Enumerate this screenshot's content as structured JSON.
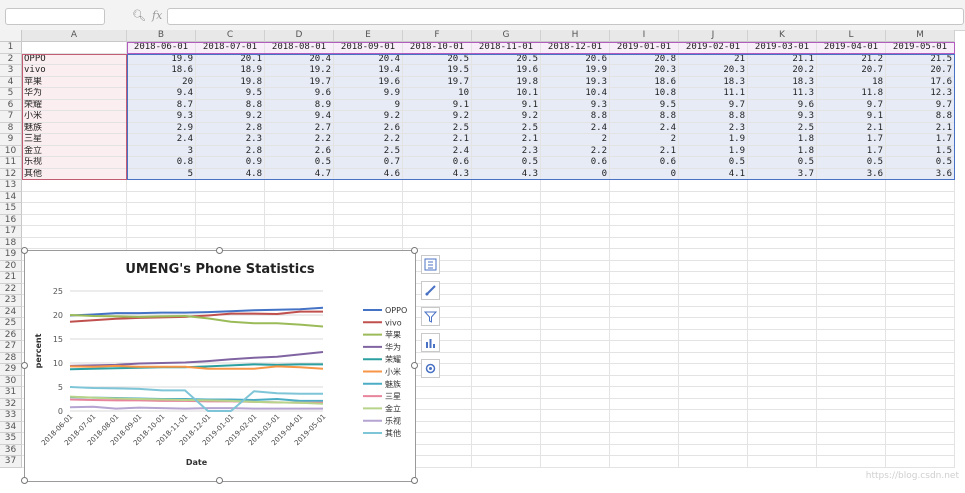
{
  "formula_bar": {
    "name_box": "",
    "formula": "",
    "fx_label": "fx"
  },
  "sheet": {
    "columns": [
      "A",
      "B",
      "C",
      "D",
      "E",
      "F",
      "G",
      "H",
      "I",
      "J",
      "K",
      "L",
      "M"
    ],
    "row_numbers": [
      "1",
      "2",
      "3",
      "4",
      "5",
      "6",
      "7",
      "8",
      "9",
      "10",
      "11",
      "12",
      "13",
      "14",
      "15",
      "16",
      "17",
      "18",
      "19",
      "20",
      "21",
      "22",
      "23",
      "24",
      "25",
      "26",
      "27",
      "28",
      "29",
      "30",
      "31",
      "32",
      "33",
      "34",
      "35",
      "36",
      "37"
    ],
    "header_row": [
      "",
      "2018-06-01",
      "2018-07-01",
      "2018-08-01",
      "2018-09-01",
      "2018-10-01",
      "2018-11-01",
      "2018-12-01",
      "2019-01-01",
      "2019-02-01",
      "2019-03-01",
      "2019-04-01",
      "2019-05-01"
    ],
    "data_rows": [
      [
        "OPPO",
        "19.9",
        "20.1",
        "20.4",
        "20.4",
        "20.5",
        "20.5",
        "20.6",
        "20.8",
        "21",
        "21.1",
        "21.2",
        "21.5"
      ],
      [
        "vivo",
        "18.6",
        "18.9",
        "19.2",
        "19.4",
        "19.5",
        "19.6",
        "19.9",
        "20.3",
        "20.3",
        "20.2",
        "20.7",
        "20.7"
      ],
      [
        "苹果",
        "20",
        "19.8",
        "19.7",
        "19.6",
        "19.7",
        "19.8",
        "19.3",
        "18.6",
        "18.3",
        "18.3",
        "18",
        "17.6"
      ],
      [
        "华为",
        "9.4",
        "9.5",
        "9.6",
        "9.9",
        "10",
        "10.1",
        "10.4",
        "10.8",
        "11.1",
        "11.3",
        "11.8",
        "12.3"
      ],
      [
        "荣耀",
        "8.7",
        "8.8",
        "8.9",
        "9",
        "9.1",
        "9.1",
        "9.3",
        "9.5",
        "9.7",
        "9.6",
        "9.7",
        "9.7"
      ],
      [
        "小米",
        "9.3",
        "9.2",
        "9.4",
        "9.2",
        "9.2",
        "9.2",
        "8.8",
        "8.8",
        "8.8",
        "9.3",
        "9.1",
        "8.8"
      ],
      [
        "魅族",
        "2.9",
        "2.8",
        "2.7",
        "2.6",
        "2.5",
        "2.5",
        "2.4",
        "2.4",
        "2.3",
        "2.5",
        "2.1",
        "2.1"
      ],
      [
        "三星",
        "2.4",
        "2.3",
        "2.2",
        "2.2",
        "2.1",
        "2.1",
        "2",
        "2",
        "1.9",
        "1.8",
        "1.7",
        "1.7"
      ],
      [
        "金立",
        "3",
        "2.8",
        "2.6",
        "2.5",
        "2.4",
        "2.3",
        "2.2",
        "2.1",
        "1.9",
        "1.8",
        "1.7",
        "1.5"
      ],
      [
        "乐视",
        "0.8",
        "0.9",
        "0.5",
        "0.7",
        "0.6",
        "0.5",
        "0.6",
        "0.6",
        "0.5",
        "0.5",
        "0.5",
        "0.5"
      ],
      [
        "其他",
        "5",
        "4.8",
        "4.7",
        "4.6",
        "4.3",
        "4.3",
        "0",
        "0",
        "4.1",
        "3.7",
        "3.6",
        "3.6"
      ]
    ]
  },
  "chart_data": {
    "type": "line",
    "title": "UMENG's Phone Statistics",
    "xlabel": "Date",
    "ylabel": "percent",
    "ylim": [
      0,
      25
    ],
    "yticks": [
      "0",
      "5",
      "10",
      "15",
      "20",
      "25"
    ],
    "grid": true,
    "legend": "right",
    "categories": [
      "2018-06-01",
      "2018-07-01",
      "2018-08-01",
      "2018-09-01",
      "2018-10-01",
      "2018-11-01",
      "2018-12-01",
      "2019-01-01",
      "2019-02-01",
      "2019-03-01",
      "2019-04-01",
      "2019-05-01"
    ],
    "series": [
      {
        "name": "OPPO",
        "color": "#4472c4",
        "values": [
          19.9,
          20.1,
          20.4,
          20.4,
          20.5,
          20.5,
          20.6,
          20.8,
          21,
          21.1,
          21.2,
          21.5
        ]
      },
      {
        "name": "vivo",
        "color": "#c0504d",
        "values": [
          18.6,
          18.9,
          19.2,
          19.4,
          19.5,
          19.6,
          19.9,
          20.3,
          20.3,
          20.2,
          20.7,
          20.7
        ]
      },
      {
        "name": "苹果",
        "color": "#9bbb59",
        "values": [
          20,
          19.8,
          19.7,
          19.6,
          19.7,
          19.8,
          19.3,
          18.6,
          18.3,
          18.3,
          18,
          17.6
        ]
      },
      {
        "name": "华为",
        "color": "#8064a2",
        "values": [
          9.4,
          9.5,
          9.6,
          9.9,
          10,
          10.1,
          10.4,
          10.8,
          11.1,
          11.3,
          11.8,
          12.3
        ]
      },
      {
        "name": "荣耀",
        "color": "#2ca0a0",
        "values": [
          8.7,
          8.8,
          8.9,
          9,
          9.1,
          9.1,
          9.3,
          9.5,
          9.7,
          9.6,
          9.7,
          9.7
        ]
      },
      {
        "name": "小米",
        "color": "#f79646",
        "values": [
          9.3,
          9.2,
          9.4,
          9.2,
          9.2,
          9.2,
          8.8,
          8.8,
          8.8,
          9.3,
          9.1,
          8.8
        ]
      },
      {
        "name": "魅族",
        "color": "#4bacc6",
        "values": [
          2.9,
          2.8,
          2.7,
          2.6,
          2.5,
          2.5,
          2.4,
          2.4,
          2.3,
          2.5,
          2.1,
          2.1
        ]
      },
      {
        "name": "三星",
        "color": "#e8859c",
        "values": [
          2.4,
          2.3,
          2.2,
          2.2,
          2.1,
          2.1,
          2,
          2,
          1.9,
          1.8,
          1.7,
          1.7
        ]
      },
      {
        "name": "金立",
        "color": "#b7d48a",
        "values": [
          3,
          2.8,
          2.6,
          2.5,
          2.4,
          2.3,
          2.2,
          2.1,
          1.9,
          1.8,
          1.7,
          1.5
        ]
      },
      {
        "name": "乐视",
        "color": "#b5a3d1",
        "values": [
          0.8,
          0.9,
          0.5,
          0.7,
          0.6,
          0.5,
          0.6,
          0.6,
          0.5,
          0.5,
          0.5,
          0.5
        ]
      },
      {
        "name": "其他",
        "color": "#7ec5d8",
        "values": [
          5,
          4.8,
          4.7,
          4.6,
          4.3,
          4.3,
          0,
          0,
          4.1,
          3.7,
          3.6,
          3.6
        ]
      }
    ]
  },
  "side_buttons": [
    "chart-elements-icon",
    "chart-styles-icon",
    "chart-filters-icon",
    "chart-type-icon",
    "chart-settings-icon"
  ],
  "watermark": "https://blog.csdn.net"
}
